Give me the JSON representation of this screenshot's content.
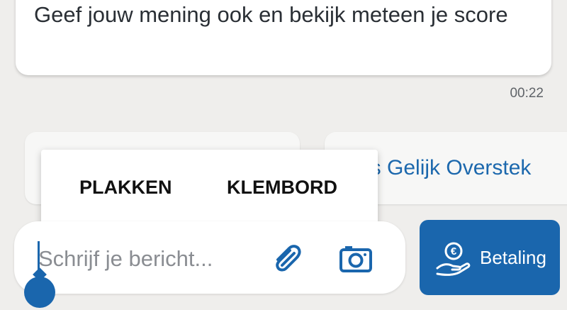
{
  "message": {
    "text": "Geef jouw mening ook en bekijk meteen je score",
    "time": "00:22"
  },
  "quick_replies": [
    {
      "label": ""
    },
    {
      "label": "es Gelijk Overstek"
    }
  ],
  "context_menu": {
    "paste_label": "PLAKKEN",
    "clipboard_label": "KLEMBORD"
  },
  "composer": {
    "placeholder": "Schrijf je bericht..."
  },
  "payment": {
    "label": "Betaling"
  },
  "colors": {
    "accent": "#1a66ad",
    "background": "#efeeec"
  },
  "icons": {
    "attach": "paperclip-icon",
    "camera": "camera-icon",
    "payment": "euro-hand-icon"
  }
}
